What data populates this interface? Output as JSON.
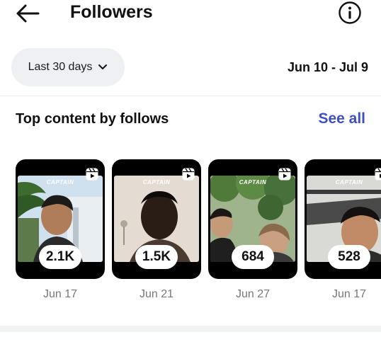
{
  "header": {
    "title": "Followers"
  },
  "filter": {
    "range_label": "Last 30 days",
    "date_span": "Jun 10 - Jul 9"
  },
  "top_content": {
    "title": "Top content by follows",
    "see_all_label": "See all",
    "items": [
      {
        "brand": "CAPTAIN",
        "follows": "2.1K",
        "date": "Jun 17"
      },
      {
        "brand": "CAPTAIN",
        "follows": "1.5K",
        "date": "Jun 21"
      },
      {
        "brand": "CAPTAIN",
        "follows": "684",
        "date": "Jun 27"
      },
      {
        "brand": "CAPTAIN",
        "follows": "528",
        "date": "Jun 17"
      }
    ]
  },
  "colors": {
    "accent_link": "#3d4fc1",
    "pill_bg": "#eef0f3",
    "card_bg": "#000000"
  },
  "icons": [
    "back-arrow-icon",
    "info-icon",
    "chevron-down-icon",
    "reels-icon"
  ]
}
